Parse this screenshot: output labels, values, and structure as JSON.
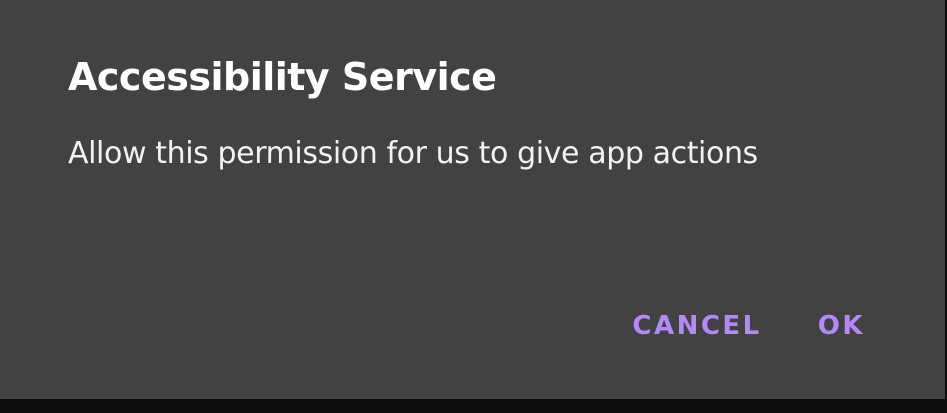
{
  "dialog": {
    "title": "Accessibility Service",
    "message": "Allow this permission for us to give app actions",
    "cancel_label": "CANCEL",
    "ok_label": "OK"
  },
  "colors": {
    "dialog_background": "#424242",
    "accent": "#b388ff",
    "title_text": "#ffffff",
    "message_text": "#f2f2f2"
  }
}
